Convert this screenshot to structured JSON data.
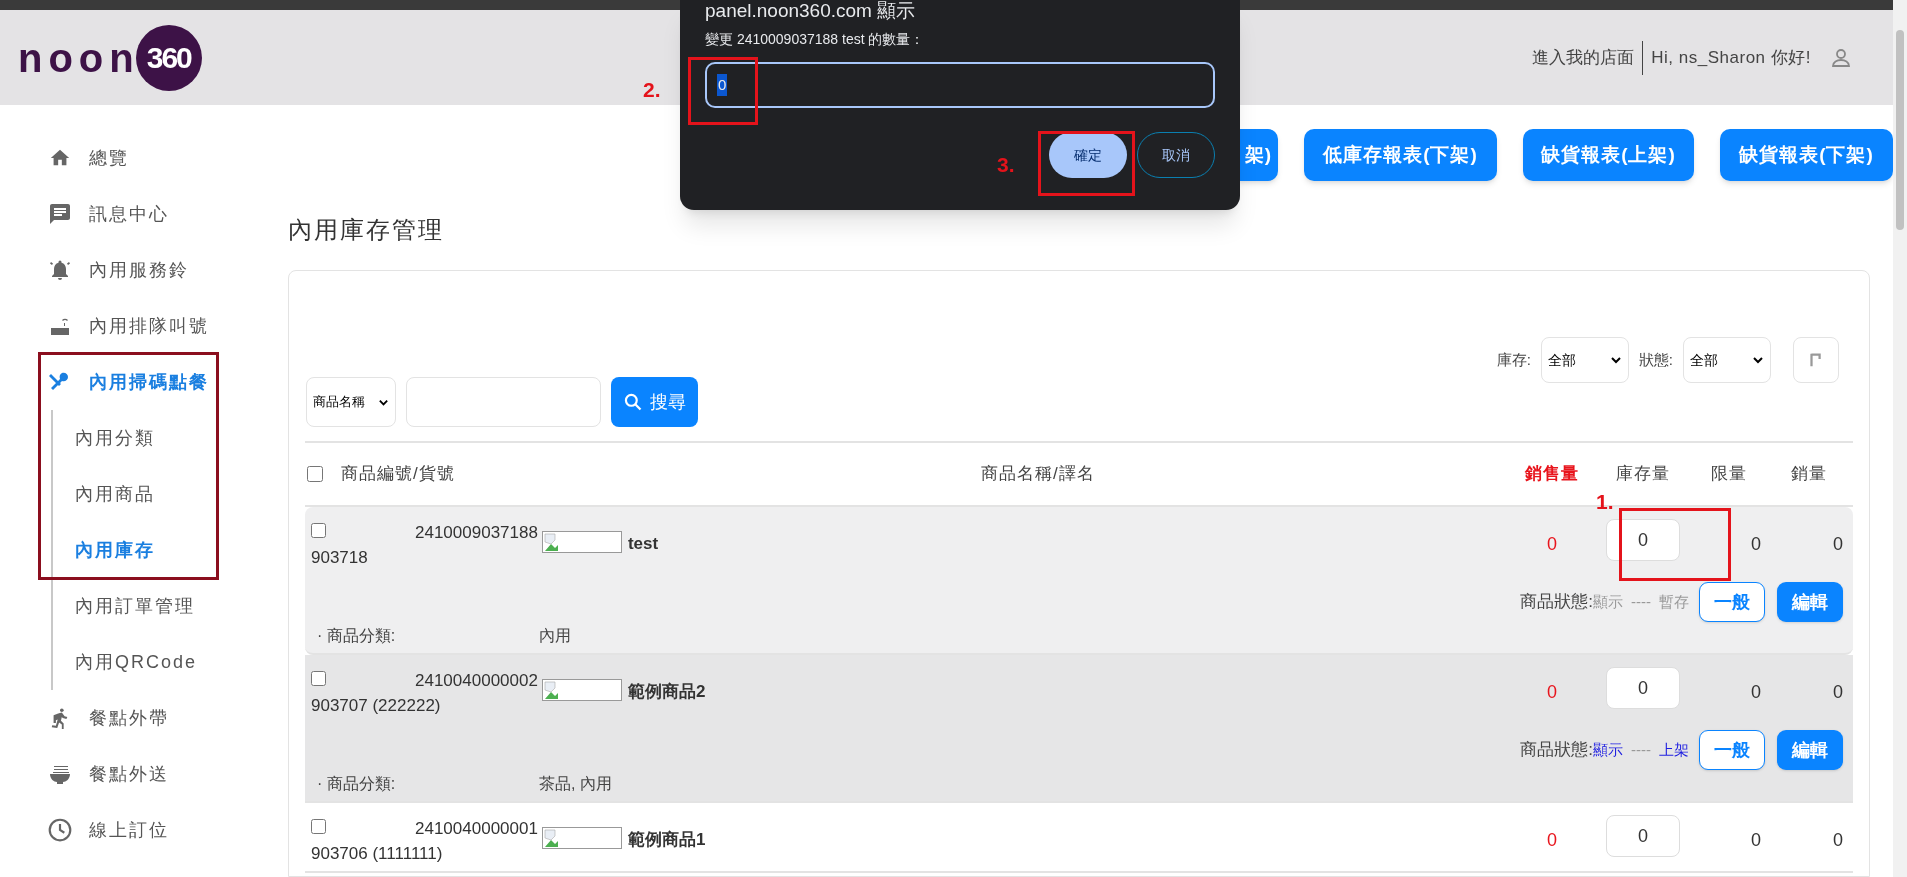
{
  "header": {
    "logo_text": "noon",
    "logo_badge": "360",
    "store_link": "進入我的店面",
    "greeting": "Hi, ns_Sharon 你好!"
  },
  "sidebar": {
    "items": [
      {
        "label": "總覽",
        "selected": false
      },
      {
        "label": "訊息中心",
        "selected": false
      },
      {
        "label": "內用服務鈴",
        "selected": false
      },
      {
        "label": "內用排隊叫號",
        "selected": false
      },
      {
        "label": "內用掃碼點餐",
        "selected": true,
        "expanded": true,
        "children": [
          {
            "label": "內用分類",
            "selected": false
          },
          {
            "label": "內用商品",
            "selected": false
          },
          {
            "label": "內用庫存",
            "selected": true
          },
          {
            "label": "內用訂單管理",
            "selected": false
          },
          {
            "label": "內用QRCode",
            "selected": false
          }
        ]
      },
      {
        "label": "餐點外帶",
        "selected": false
      },
      {
        "label": "餐點外送",
        "selected": false
      },
      {
        "label": "線上訂位",
        "selected": false
      }
    ]
  },
  "report_buttons": [
    "架)",
    "低庫存報表(下架)",
    "缺貨報表(上架)",
    "缺貨報表(下架)"
  ],
  "page_title": "內用庫存管理",
  "filters": [
    {
      "label": "庫存:",
      "value": "全部"
    },
    {
      "label": "狀態:",
      "value": "全部"
    }
  ],
  "search": {
    "field_select": "商品名稱",
    "button": "搜尋"
  },
  "table": {
    "select_all": false,
    "columns": [
      {
        "label": "商品編號/貨號",
        "emphasized": false
      },
      {
        "label": "商品名稱/譯名",
        "emphasized": false
      },
      {
        "label": "銷售量",
        "emphasized": true
      },
      {
        "label": "庫存量",
        "emphasized": false
      },
      {
        "label": "限量",
        "emphasized": false
      },
      {
        "label": "銷量",
        "emphasized": false
      }
    ],
    "rows": [
      {
        "checked": false,
        "highlighted": true,
        "id": "903718",
        "code": "2410009037188",
        "name": "test",
        "sales": "0",
        "stock": "0",
        "limit": "0",
        "sold": "0",
        "status_label": "商品狀態:",
        "display": "顯示",
        "separator": "----",
        "shelf": "暫存",
        "status_active": false,
        "type_button": "一般",
        "edit_button": "編輯",
        "category_label": "· 商品分類:",
        "category": "內用"
      },
      {
        "checked": false,
        "highlighted": false,
        "id": "903707 (222222)",
        "code": "2410040000002",
        "name": "範例商品2",
        "sales": "0",
        "stock": "0",
        "limit": "0",
        "sold": "0",
        "status_label": "商品狀態:",
        "display": "顯示",
        "separator": "----",
        "shelf": "上架",
        "status_active": true,
        "type_button": "一般",
        "edit_button": "編輯",
        "category_label": "· 商品分類:",
        "category": "茶品, 內用"
      },
      {
        "checked": false,
        "highlighted": false,
        "id": "903706 (1111111)",
        "code": "2410040000001",
        "name": "範例商品1",
        "sales": "0",
        "stock": "0",
        "limit": "0",
        "sold": "0"
      }
    ]
  },
  "dialog": {
    "title": "panel.noon360.com 顯示",
    "message": "變更 2410009037188 test 的數量：",
    "value": "0",
    "value_selected": true,
    "buttons": [
      {
        "label": "確定",
        "primary": true
      },
      {
        "label": "取消",
        "primary": false
      }
    ]
  },
  "annotations": [
    {
      "label": "1."
    },
    {
      "label": "2."
    },
    {
      "label": "3."
    }
  ]
}
